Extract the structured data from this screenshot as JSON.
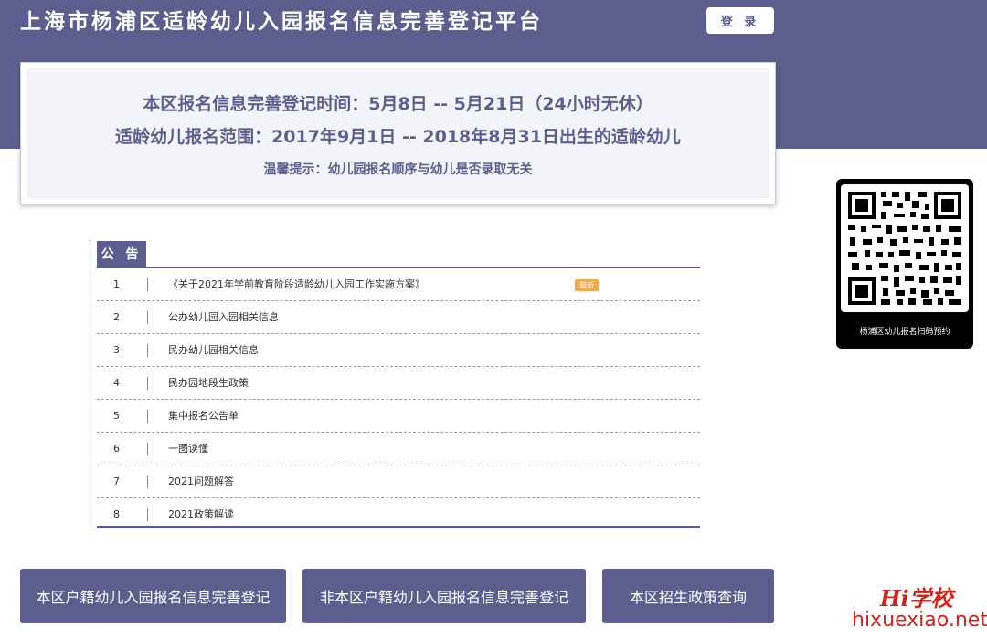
{
  "header": {
    "title": "上海市杨浦区适龄幼儿入园报名信息完善登记平台",
    "login_label": "登 录"
  },
  "info": {
    "line1": "本区报名信息完善登记时间：5月8日 -- 5月21日（24小时无休）",
    "line2": "适龄幼儿报名范围：2017年9月1日 -- 2018年8月31日出生的适龄幼儿",
    "line3": "温馨提示：幼儿园报名顺序与幼儿是否录取无关"
  },
  "notices": {
    "tab_label": "公 告",
    "new_badge": "最新",
    "items": [
      {
        "num": "1",
        "title": "《关于2021年学前教育阶段适龄幼儿入园工作实施方案》"
      },
      {
        "num": "2",
        "title": "公办幼儿园入园相关信息"
      },
      {
        "num": "3",
        "title": "民办幼儿园相关信息"
      },
      {
        "num": "4",
        "title": "民办园地段生政策"
      },
      {
        "num": "5",
        "title": "集中报名公告单"
      },
      {
        "num": "6",
        "title": "一图读懂"
      },
      {
        "num": "7",
        "title": "2021问题解答"
      },
      {
        "num": "8",
        "title": "2021政策解读"
      }
    ]
  },
  "qr": {
    "caption": "杨浦区幼儿报名扫码预约"
  },
  "actions": {
    "local_label": "本区户籍幼儿入园报名信息完善登记",
    "nonlocal_label": "非本区户籍幼儿入园报名信息完善登记",
    "policy_label": "本区招生政策查询"
  },
  "watermark": {
    "logo": "Hi学校",
    "url": "hixuexiao.net"
  },
  "colors": {
    "brand": "#5c5f8d",
    "badge": "#f0a848",
    "watermark": "#d0241b"
  }
}
